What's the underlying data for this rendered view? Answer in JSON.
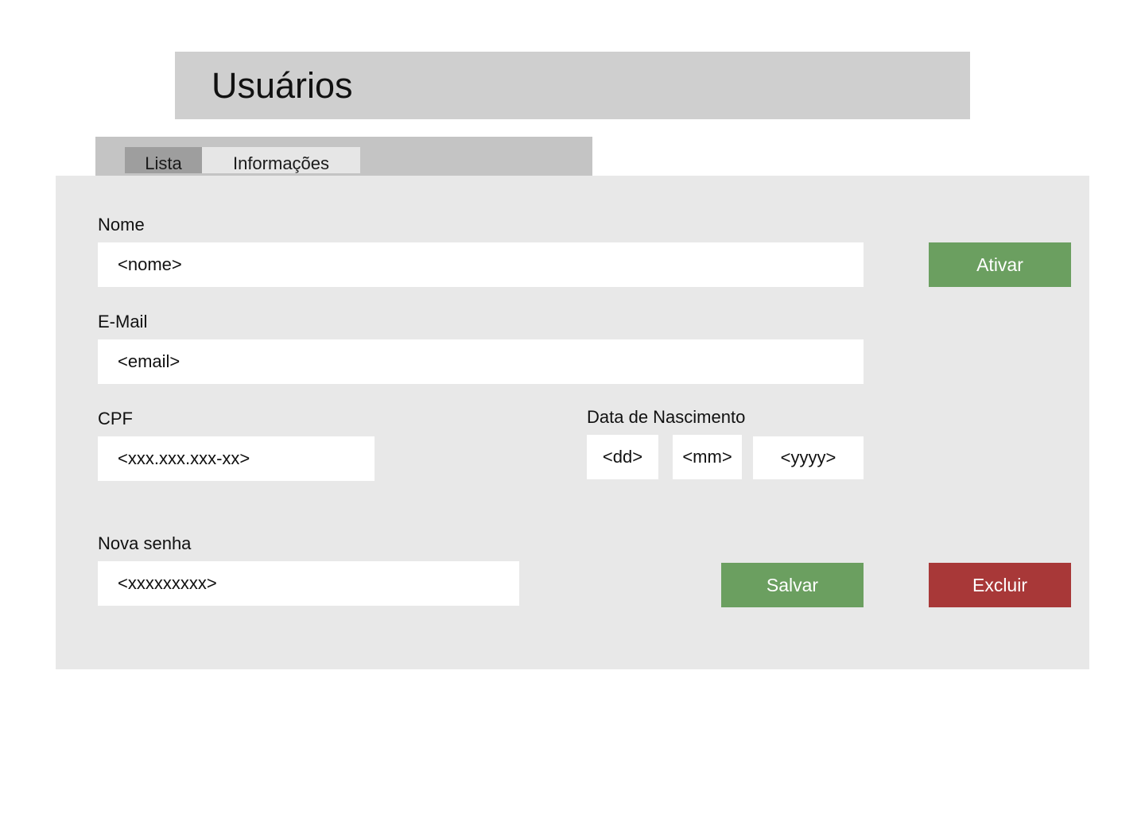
{
  "header": {
    "title": "Usuários"
  },
  "tabs": [
    {
      "label": "Lista",
      "active": true
    },
    {
      "label": "Informações",
      "active": false
    }
  ],
  "form": {
    "nome": {
      "label": "Nome",
      "value": "<nome>"
    },
    "email": {
      "label": "E-Mail",
      "value": "<email>"
    },
    "cpf": {
      "label": "CPF",
      "value": "<xxx.xxx.xxx-xx>"
    },
    "data_nascimento": {
      "label": "Data de Nascimento",
      "day": "<dd>",
      "month": "<mm>",
      "year": "<yyyy>"
    },
    "nova_senha": {
      "label": "Nova senha",
      "value": "<xxxxxxxxx>"
    }
  },
  "buttons": {
    "ativar": "Ativar",
    "salvar": "Salvar",
    "excluir": "Excluir"
  },
  "colors": {
    "title_bar": "#cfcfcf",
    "tab_strip": "#c4c4c4",
    "tab_active": "#9e9e9e",
    "tab_inactive": "#e6e6e6",
    "panel": "#e8e8e8",
    "green": "#6b9f60",
    "red": "#a83838"
  }
}
